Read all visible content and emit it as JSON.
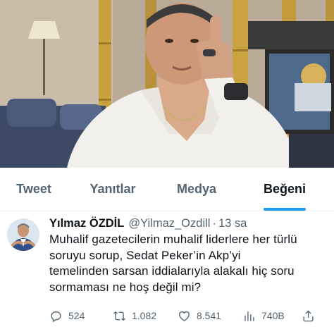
{
  "header_media": {
    "description_icon": "video-frame-image"
  },
  "tabs": [
    {
      "label": "Tweet",
      "active": false
    },
    {
      "label": "Yanıtlar",
      "active": false
    },
    {
      "label": "Medya",
      "active": false
    },
    {
      "label": "Beğeni",
      "active": true
    }
  ],
  "tweet": {
    "author_name": "Yılmaz ÖZDİL",
    "handle": "@Yilmaz_Ozdill",
    "separator": "·",
    "time": "13 sa",
    "text": "Muhalif gazetecilerin muhalif liderlere her türlü\nsoruyu sorup, Sedat Peker’in Akp’yi\ntemelinden sarsan iddialarıyla alakalı hiç soru\nsormaması ne hoş değil mi?",
    "replies": "524",
    "retweets": "1.082",
    "likes": "8.541",
    "views": "740B"
  },
  "colors": {
    "accent": "#1d9bf0",
    "secondary_text": "#536471",
    "primary_text": "#0f1419"
  }
}
